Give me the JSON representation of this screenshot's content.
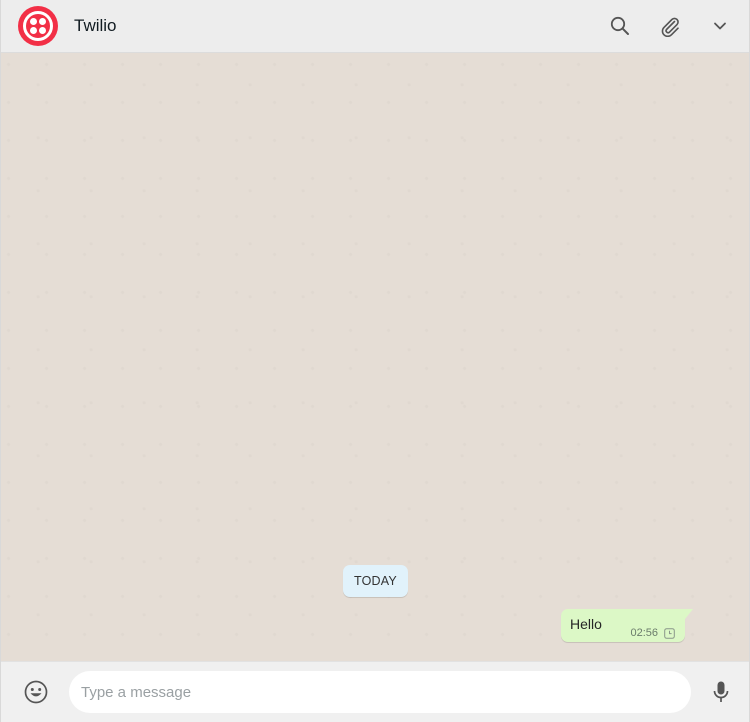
{
  "header": {
    "title": "Twilio",
    "brand_color": "#f22f46",
    "icons": [
      "search-icon",
      "paperclip-icon",
      "chevron-down-icon"
    ]
  },
  "chat": {
    "date_chip": "TODAY",
    "messages": [
      {
        "text": "Hello",
        "time": "02:56",
        "direction": "outgoing",
        "status_icon": "clock-icon"
      }
    ],
    "background_color": "#e5ddd5",
    "outgoing_bubble_color": "#dcf8c6"
  },
  "composer": {
    "placeholder": "Type a message",
    "value": "",
    "icons": [
      "emoji-icon",
      "microphone-icon"
    ]
  }
}
